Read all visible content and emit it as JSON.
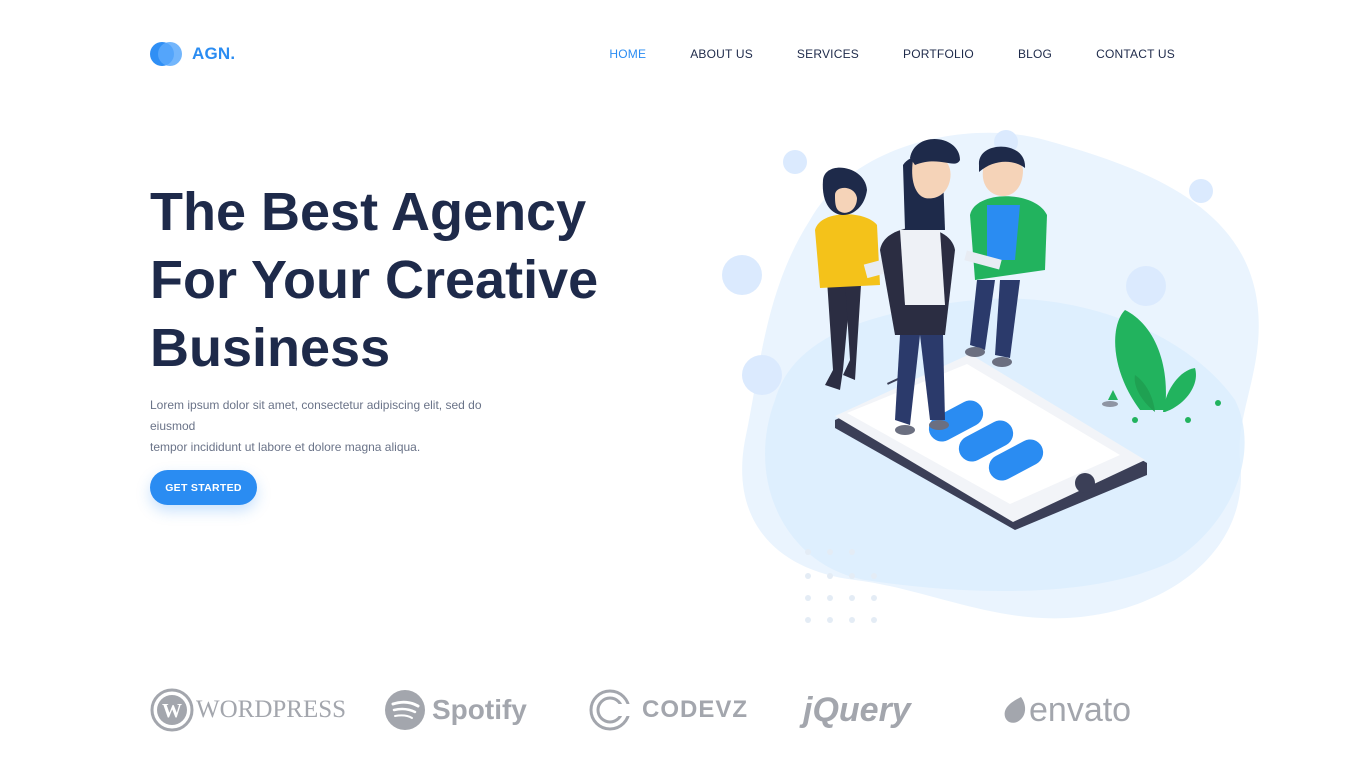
{
  "brand": {
    "name": "AGN.",
    "accent": "#2a8cf2"
  },
  "nav": {
    "items": [
      {
        "label": "HOME",
        "active": true
      },
      {
        "label": "ABOUT US",
        "active": false
      },
      {
        "label": "SERVICES",
        "active": false
      },
      {
        "label": "PORTFOLIO",
        "active": false
      },
      {
        "label": "BLOG",
        "active": false
      },
      {
        "label": "CONTACT US",
        "active": false
      }
    ]
  },
  "hero": {
    "title_lines": [
      "The Best Agency",
      "For Your Creative",
      "Business"
    ],
    "text_lines": [
      "Lorem ipsum dolor sit amet, consectetur adipiscing elit, sed do eiusmod",
      "tempor incididunt ut labore et dolore magna aliqua."
    ],
    "cta_label": "GET STARTED"
  },
  "partners": [
    {
      "name": "WORDPRESS",
      "icon": "wordpress-logo-icon"
    },
    {
      "name": "Spotify",
      "icon": "spotify-logo-icon"
    },
    {
      "name": "CODEVZ",
      "icon": "codevz-logo-icon"
    },
    {
      "name": "jQuery",
      "icon": "jquery-logo-icon"
    },
    {
      "name": "envato",
      "icon": "envato-logo-icon"
    }
  ]
}
